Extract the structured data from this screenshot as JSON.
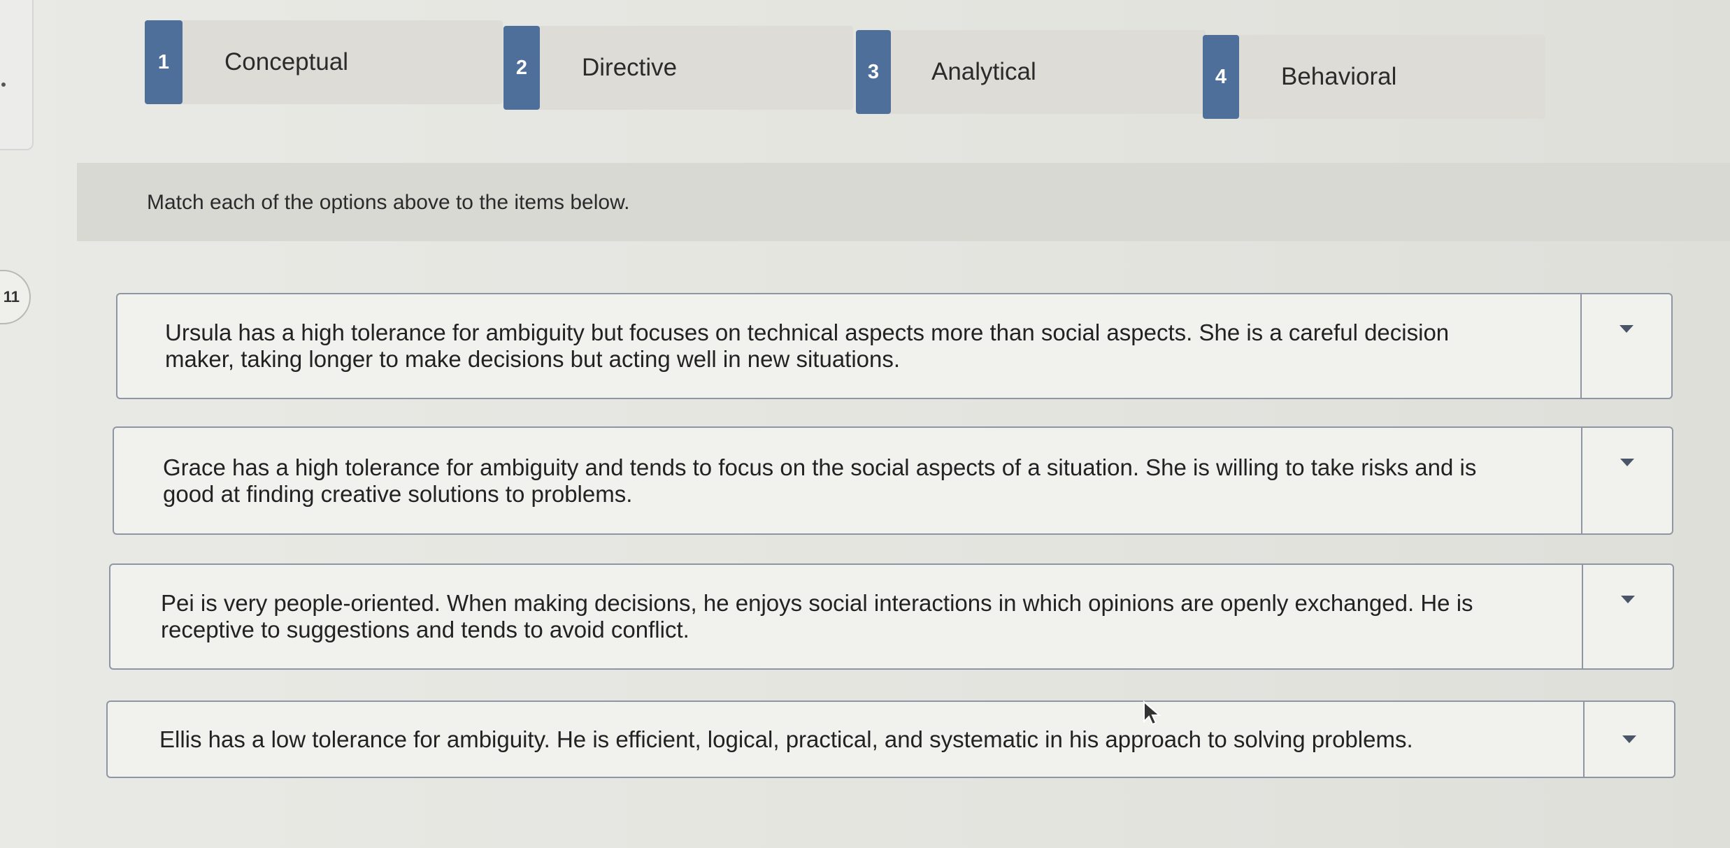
{
  "question_number": "11",
  "options": [
    {
      "number": "1",
      "label": "Conceptual"
    },
    {
      "number": "2",
      "label": "Directive"
    },
    {
      "number": "3",
      "label": "Analytical"
    },
    {
      "number": "4",
      "label": "Behavioral"
    }
  ],
  "instructions": "Match each of the options above to the items below.",
  "items": [
    {
      "text": "Ursula has a high tolerance for ambiguity but focuses on technical aspects more than social aspects. She is a careful decision maker, taking longer to make decisions but acting well in new situations.",
      "selected": ""
    },
    {
      "text": "Grace has a high tolerance for ambiguity and tends to focus on the social aspects of a situation. She is willing to take risks and is good at finding creative solutions to problems.",
      "selected": ""
    },
    {
      "text": "Pei is very people-oriented. When making decisions, he enjoys social interactions in which opinions are openly exchanged. He is receptive to suggestions and tends to avoid conflict.",
      "selected": ""
    },
    {
      "text": "Ellis has a low tolerance for ambiguity. He is efficient, logical, practical, and systematic in his approach to solving problems.",
      "selected": ""
    }
  ],
  "icons": {
    "dropdown": "chevron-down-icon",
    "cursor": "mouse-pointer-icon"
  },
  "colors": {
    "badge": "#4f6f9b",
    "border": "#8e96a4"
  }
}
